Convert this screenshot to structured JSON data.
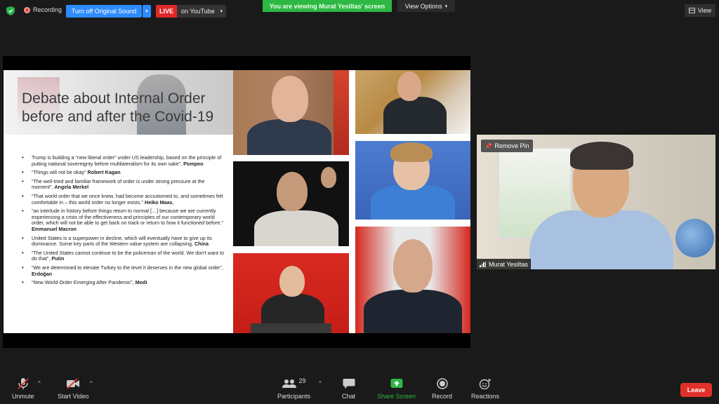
{
  "topbar": {
    "recording_label": "Recording",
    "sound_button": "Turn off Original Sound",
    "live_badge": "LIVE",
    "live_target": "on YouTube",
    "viewing_banner": "You are viewing Murat Yesiltas' screen",
    "view_options": "View Options",
    "view_button": "View"
  },
  "slide": {
    "title": "Debate about Internal Order before and after the Covid-19",
    "bullets": [
      {
        "text": "Trump is building a “new liberal order” under US leadership, based on the principle of putting national sovereignty before multilateralism for its own sake”, ",
        "author": "Pompeo"
      },
      {
        "text": "“Things will not be okay” ",
        "author": "Robert Kagan"
      },
      {
        "text": "“The well-tried and familiar framework of order is under strong pressure at the moment”, ",
        "author": "Angela Merkel"
      },
      {
        "text": "“That world order that we once knew, had become accustomed to, and sometimes felt comfortable in – this world order no longer exists.” ",
        "author": "Heiko Maas"
      },
      {
        "text": "“an interlude in history before things return to normal […] because we are currently experiencing a crisis of the effectiveness and principles of our contemporary world order, which will not be able to get back on track or return to how it functioned before.” ",
        "author": "Emmanuel Macron"
      },
      {
        "text": "United States is a superpower in decline, which will eventually have to give up its dominance. Some key parts of the Western value system are collapsing, ",
        "author": "China"
      },
      {
        "text": "“The United States cannot continue to be the policeman of the world. We don’t want to do that”, ",
        "author": "Putin"
      },
      {
        "text": "“We are determined to elevate Turkey to the level it deserves in the new global order”, ",
        "author": "Erdoğan"
      },
      {
        "text": "“New World Order Emerging After Pandemic”, ",
        "author": "Modi"
      }
    ],
    "bullet_suffix_3": ","
  },
  "video": {
    "remove_pin": "Remove Pin",
    "participant_name": "Murat Yesiltas"
  },
  "toolbar": {
    "unmute": "Unmute",
    "start_video": "Start Video",
    "participants": "Participants",
    "participants_count": "29",
    "chat": "Chat",
    "share_screen": "Share Screen",
    "record": "Record",
    "reactions": "Reactions",
    "leave": "Leave"
  },
  "colors": {
    "zoom_blue": "#2d8cff",
    "live_red": "#e02828",
    "share_green": "#2db843",
    "leave_red": "#e0302a"
  }
}
